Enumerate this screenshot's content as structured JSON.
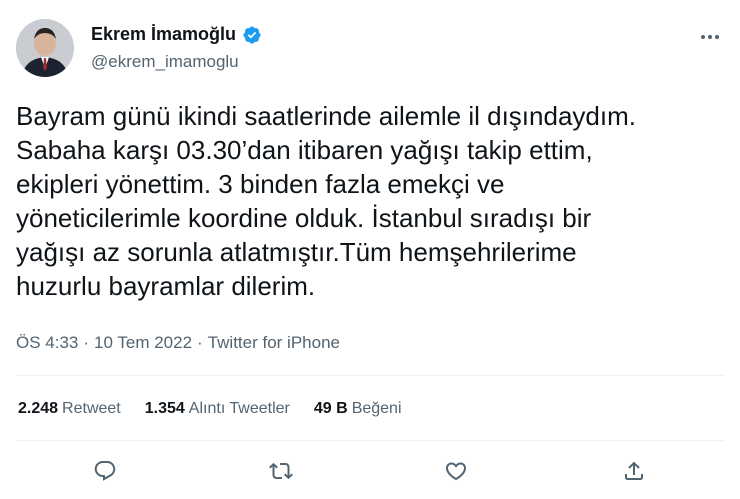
{
  "author": {
    "name": "Ekrem İmamoğlu",
    "handle": "@ekrem_imamoglu",
    "verified": true
  },
  "tweet": {
    "text": "Bayram günü ikindi saatlerinde ailemle il dışındaydım.\nSabaha karşı 03.30’dan itibaren yağışı takip ettim,\nekipleri yönettim. 3 binden fazla emekçi ve\nyöneticilerimle koordine olduk. İstanbul sıradışı bir\nyağışı az sorunla atlatmıştır.Tüm hemşehrilerime\nhuzurlu bayramlar dilerim.",
    "time": "ÖS 4:33",
    "separator": "·",
    "date": "10 Tem 2022",
    "source": "Twitter for iPhone"
  },
  "stats": {
    "retweets_count": "2.248",
    "retweets_label": "Retweet",
    "quotes_count": "1.354",
    "quotes_label": "Alıntı Tweetler",
    "likes_count": "49 B",
    "likes_label": "Beğeni"
  },
  "icons": {
    "more": "more-dots-icon",
    "reply": "reply-icon",
    "retweet": "retweet-icon",
    "like": "heart-icon",
    "share": "share-icon",
    "verified": "verified-badge-icon"
  },
  "colors": {
    "text": "#0f1419",
    "secondary": "#536471",
    "verified": "#1d9bf0",
    "divider": "#eff3f4"
  }
}
